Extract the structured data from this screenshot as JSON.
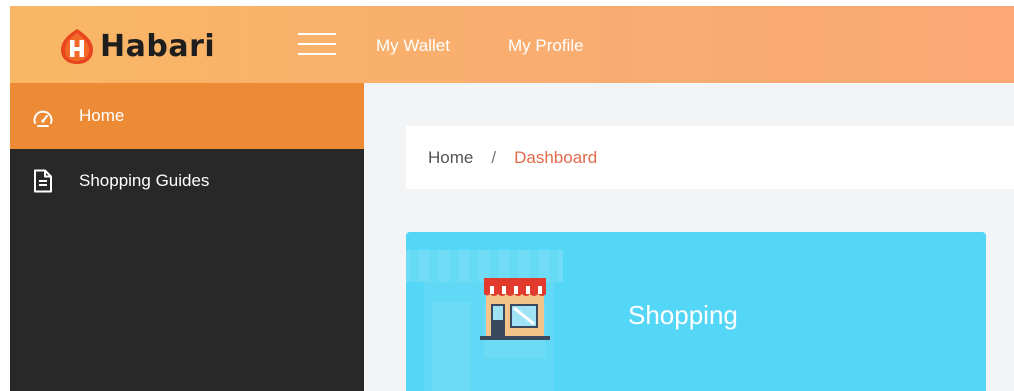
{
  "header": {
    "logo_text": "Habari",
    "nav": [
      {
        "label": "My Wallet"
      },
      {
        "label": "My Profile"
      }
    ]
  },
  "sidebar": {
    "items": [
      {
        "label": "Home",
        "icon": "dashboard-gauge-icon",
        "active": true
      },
      {
        "label": "Shopping Guides",
        "icon": "document-icon",
        "active": false
      }
    ]
  },
  "breadcrumb": {
    "home": "Home",
    "separator": "/",
    "current": "Dashboard"
  },
  "cards": [
    {
      "label": "Shopping",
      "icon": "storefront-icon",
      "color": "#54d6f6"
    }
  ],
  "colors": {
    "header_gradient_start": "#f9b764",
    "header_gradient_end": "#fba874",
    "sidebar_bg": "#282828",
    "sidebar_active": "#ec8a36",
    "breadcrumb_current": "#e16a4a",
    "main_bg": "#f2f4f6"
  }
}
